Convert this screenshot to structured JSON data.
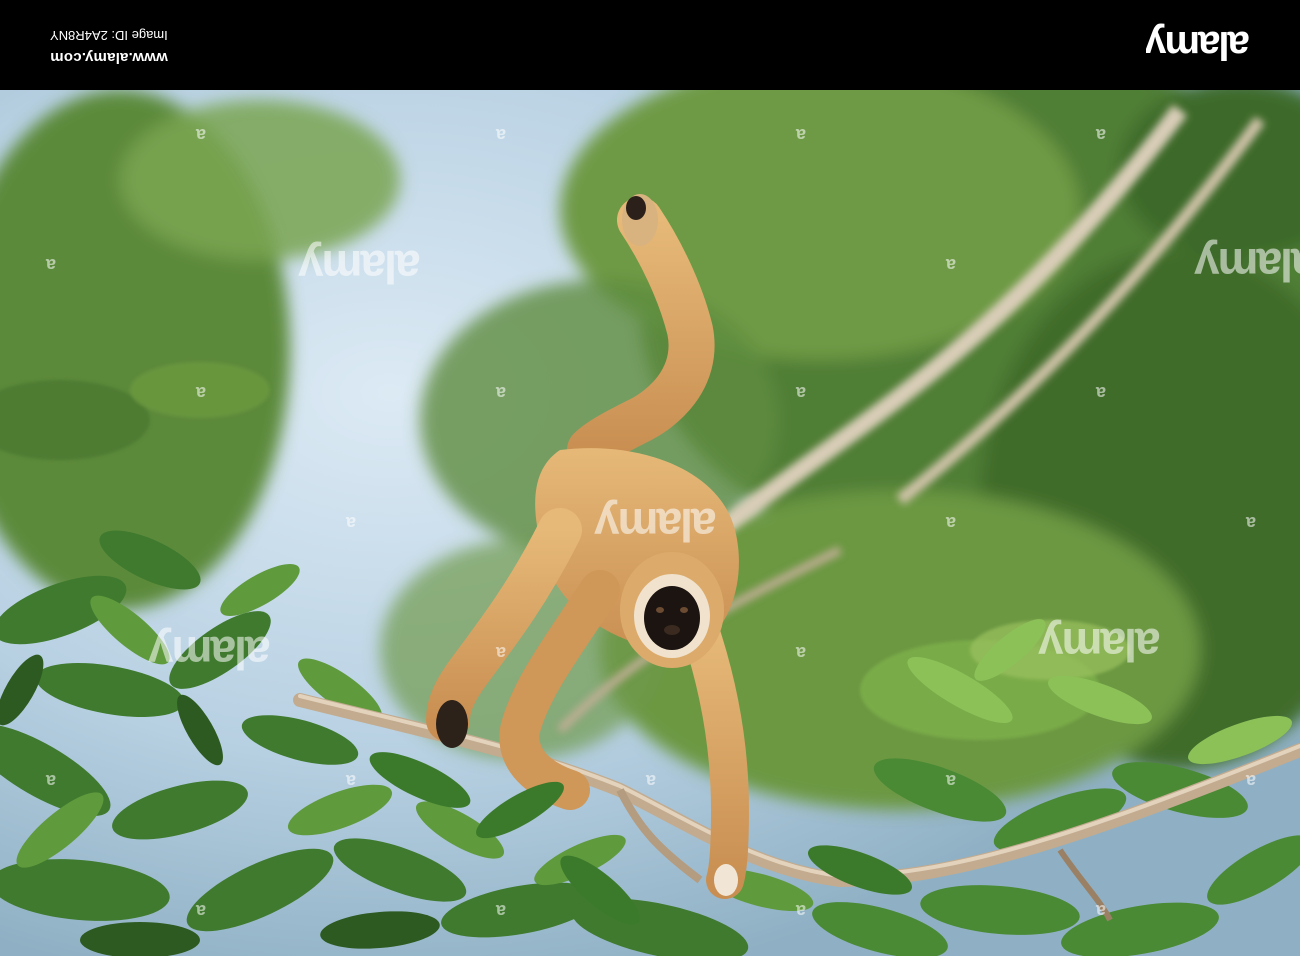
{
  "banner": {
    "logo_text": "alamy",
    "website": "www.alamy.com",
    "image_id": "Image ID: 2A4R8NY"
  },
  "photo": {
    "watermark_text": "alamy",
    "watermark_mark": "a"
  },
  "colors": {
    "banner_bg": "#000000",
    "sky": "#b9d3e6",
    "foliage_dark": "#2f5a24",
    "foliage_light": "#7fae4c",
    "gibbon_fur": "#d9a765",
    "gibbon_face": "#1c1410",
    "branch": "#c9b39a"
  }
}
